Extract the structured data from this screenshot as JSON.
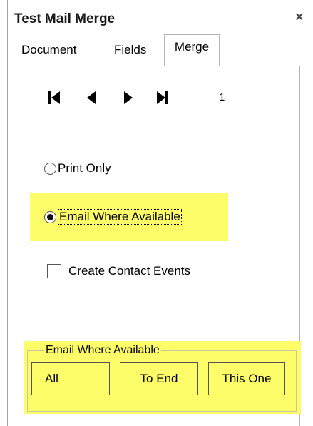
{
  "window": {
    "title": "Test Mail Merge",
    "close_symbol": "×"
  },
  "tabs": [
    {
      "label": "Document",
      "active": false
    },
    {
      "label": "Fields",
      "active": false
    },
    {
      "label": "Merge",
      "active": true
    }
  ],
  "navigator": {
    "record": "1"
  },
  "options": {
    "print_only": {
      "label": "Print Only",
      "selected": false
    },
    "email_where_available": {
      "label": "Email Where Available",
      "selected": true
    },
    "create_contact_events": {
      "label": "Create Contact Events",
      "checked": false
    }
  },
  "email_group": {
    "label": "Email Where Available",
    "buttons": {
      "all": "All",
      "to_end": "To End",
      "this_one": "This One"
    }
  },
  "colors": {
    "highlight": "#fdfd6a"
  }
}
